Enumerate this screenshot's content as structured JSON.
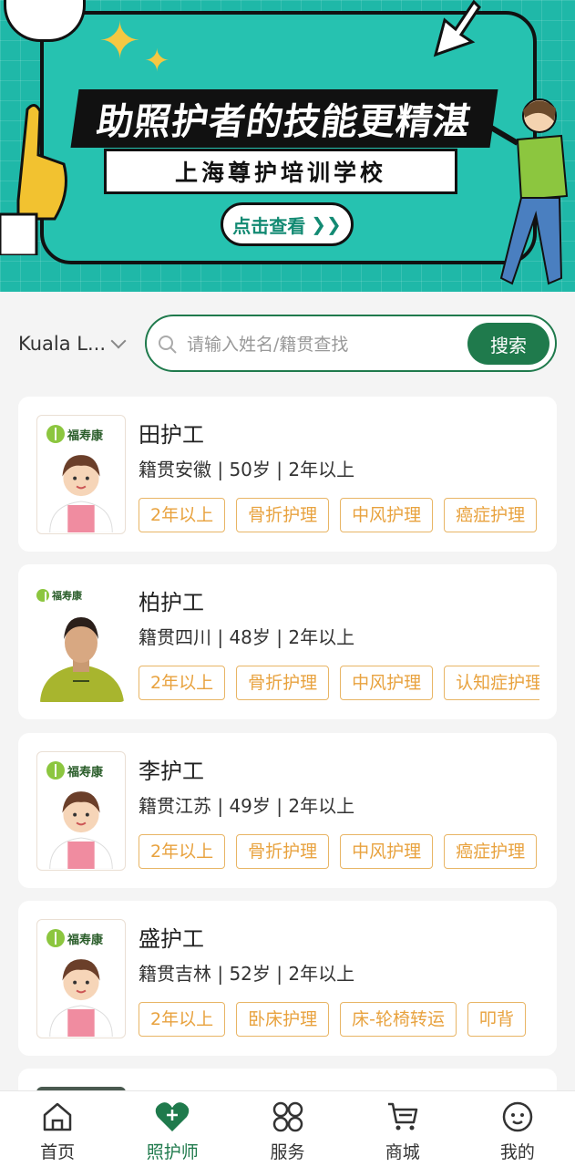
{
  "banner": {
    "title": "助照护者的技能更精湛",
    "subtitle": "上海尊护培训学校",
    "cta": "点击查看"
  },
  "search": {
    "location": "Kuala L...",
    "placeholder": "请输入姓名/籍贯查找",
    "button": "搜索"
  },
  "caregivers": [
    {
      "name": "田护工",
      "info": "籍贯安徽 | 50岁 | 2年以上",
      "tags": [
        "2年以上",
        "骨折护理",
        "中风护理",
        "癌症护理"
      ],
      "photo": "cartoon-avatar",
      "logo": "福寿康"
    },
    {
      "name": "柏护工",
      "info": "籍贯四川 | 48岁 | 2年以上",
      "tags": [
        "2年以上",
        "骨折护理",
        "中风护理",
        "认知症护理"
      ],
      "photo": "real-photo",
      "logo": "福寿康"
    },
    {
      "name": "李护工",
      "info": "籍贯江苏 | 49岁 | 2年以上",
      "tags": [
        "2年以上",
        "骨折护理",
        "中风护理",
        "癌症护理"
      ],
      "photo": "cartoon-avatar",
      "logo": "福寿康"
    },
    {
      "name": "盛护工",
      "info": "籍贯吉林 | 52岁 | 2年以上",
      "tags": [
        "2年以上",
        "卧床护理",
        "床-轮椅转运",
        "叩背"
      ],
      "photo": "cartoon-avatar",
      "logo": "福寿康"
    }
  ],
  "tabbar": [
    {
      "label": "首页",
      "icon": "home-icon",
      "active": false
    },
    {
      "label": "照护师",
      "icon": "heart-plus-icon",
      "active": true
    },
    {
      "label": "服务",
      "icon": "services-grid-icon",
      "active": false
    },
    {
      "label": "商城",
      "icon": "cart-icon",
      "active": false
    },
    {
      "label": "我的",
      "icon": "profile-face-icon",
      "active": false
    }
  ],
  "colors": {
    "brand_green": "#1f7a4c",
    "banner_teal": "#1fb8a8",
    "tag_orange": "#e8a23e"
  }
}
